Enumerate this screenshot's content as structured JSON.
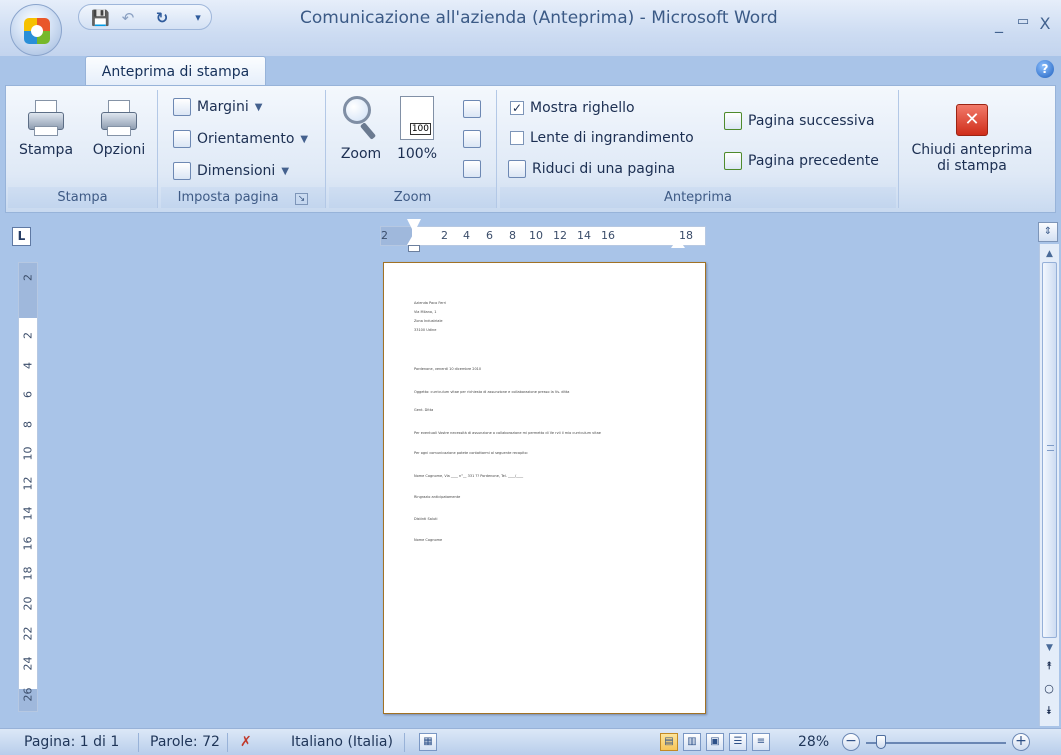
{
  "window": {
    "title": "Comunicazione all'azienda (Anteprima) - Microsoft Word",
    "minimize": "_",
    "maximize": "▭",
    "close": "X"
  },
  "qat": {
    "save": "💾",
    "undo": "↶",
    "redo": "↻",
    "customize": "▾"
  },
  "tabs": {
    "active": "Anteprima di stampa",
    "help": "?"
  },
  "groups": {
    "stampa": {
      "label": "Stampa",
      "stampa_btn": "Stampa",
      "opzioni_btn": "Opzioni"
    },
    "imposta_pagina": {
      "label": "Imposta pagina",
      "margini": "Margini",
      "orientamento": "Orientamento",
      "dimensioni": "Dimensioni"
    },
    "zoom": {
      "label": "Zoom",
      "zoom_btn": "Zoom",
      "hundred_btn": "100%",
      "page_badge": "100"
    },
    "anteprima": {
      "label": "Anteprima",
      "mostra_righello": "Mostra righello",
      "mostra_righello_checked": true,
      "lente": "Lente di ingrandimento",
      "lente_checked": false,
      "riduci": "Riduci di una pagina",
      "pagina_successiva": "Pagina successiva",
      "pagina_precedente": "Pagina precedente",
      "chiudi_line1": "Chiudi anteprima",
      "chiudi_line2": "di stampa"
    }
  },
  "ruler": {
    "toggle": "L",
    "h_ticks": [
      "2",
      "2",
      "4",
      "6",
      "8",
      "10",
      "12",
      "14",
      "16",
      "18"
    ],
    "v_ticks": [
      "2",
      "2",
      "4",
      "6",
      "8",
      "10",
      "12",
      "14",
      "16",
      "18",
      "20",
      "22",
      "24",
      "26"
    ]
  },
  "page_lines": [
    "Azienda Paco Ferri",
    "Via Milano, 1",
    "Zona Industriale",
    "33100 Udine",
    "Pordenone, venerdì 10 dicembre 2010",
    "Oggetto: curriculum vitae per richiesta di assunzione e collaborazione presso la Vs. ditta",
    "Gent. Ditta",
    "Per eventuali Vostre necessità di assunzione o collaborazione mi permetto di Ve rvii il mio curriculum vitae",
    "Per ogni comunicazione potete contattarmi al seguente recapito:",
    "Nome Cognome, Via ____ n°__ 331 ?? Pordenone, Tel. ____/____",
    "Ringrazio anticipatamente",
    "Distinti Saluti",
    "Nome Cognome"
  ],
  "status": {
    "pagina": "Pagina: 1 di 1",
    "parole": "Parole: 72",
    "lingua": "Italiano (Italia)",
    "zoom": "28%"
  }
}
